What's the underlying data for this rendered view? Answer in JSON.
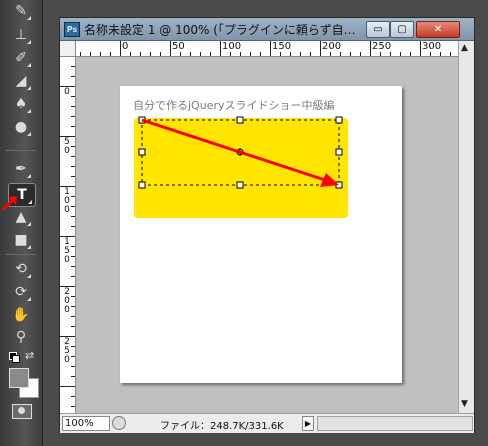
{
  "window": {
    "app_badge": "Ps",
    "title": "名称未設定 1 @ 100% (「プラグインに頼らず自…",
    "minimize": "▭",
    "maximize": "▢",
    "close": "✕"
  },
  "ruler_top_labels": [
    "0",
    "50",
    "100",
    "150",
    "200",
    "250",
    "300"
  ],
  "ruler_left_labels": [
    "0",
    "5\n0",
    "1\n0\n0",
    "1\n5\n0",
    "2\n0\n0",
    "2\n5\n0"
  ],
  "page": {
    "heading": "自分で作るjQueryスライドショー中級編"
  },
  "statusbar": {
    "zoom": "100%",
    "file_info": "ファイル：248.7K/331.6K",
    "more_arrow": "▶"
  },
  "colors": {
    "yellow_box": "#ffe500",
    "annotation_arrow": "#ff0000",
    "title_bar": "#9fb3c7"
  },
  "toolbar": {
    "tools": [
      {
        "name": "brush-tool-icon",
        "glyph": "✎"
      },
      {
        "name": "stamp-tool-icon",
        "glyph": "⊥"
      },
      {
        "name": "history-brush-icon",
        "glyph": "✐"
      },
      {
        "name": "eraser-tool-icon",
        "glyph": "◢"
      },
      {
        "name": "paint-bucket-icon",
        "glyph": "♠"
      },
      {
        "name": "blur-tool-icon",
        "glyph": "●"
      },
      {
        "name": "pen-tool-icon",
        "glyph": "✒"
      },
      {
        "name": "type-tool-icon",
        "glyph": "T"
      },
      {
        "name": "path-select-icon",
        "glyph": "▲"
      },
      {
        "name": "rectangle-tool-icon",
        "glyph": "■"
      },
      {
        "name": "rotate-3d-icon",
        "glyph": "⟲"
      },
      {
        "name": "orbit-3d-icon",
        "glyph": "⟳"
      },
      {
        "name": "hand-tool-icon",
        "glyph": "✋"
      },
      {
        "name": "zoom-tool-icon",
        "glyph": "⚲"
      }
    ],
    "swap_glyph": "⇄"
  }
}
